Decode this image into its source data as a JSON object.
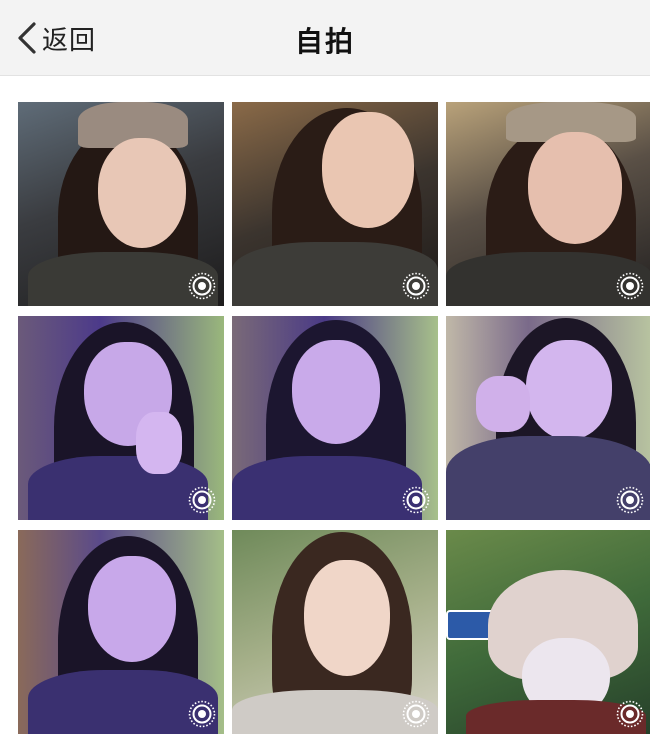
{
  "nav": {
    "back_label": "返回",
    "title": "自拍",
    "back_icon": "chevron-left-icon"
  },
  "photos": [
    {
      "id": 1,
      "badge_icon": "live-photo-icon"
    },
    {
      "id": 2,
      "badge_icon": "live-photo-icon"
    },
    {
      "id": 3,
      "badge_icon": "live-photo-icon"
    },
    {
      "id": 4,
      "badge_icon": "live-photo-icon"
    },
    {
      "id": 5,
      "badge_icon": "live-photo-icon"
    },
    {
      "id": 6,
      "badge_icon": "live-photo-icon"
    },
    {
      "id": 7,
      "badge_icon": "live-photo-icon"
    },
    {
      "id": 8,
      "badge_icon": "live-photo-icon"
    },
    {
      "id": 9,
      "badge_icon": "live-photo-icon"
    }
  ],
  "colors": {
    "nav_background": "#f3f3f3",
    "title_text": "#111111"
  }
}
